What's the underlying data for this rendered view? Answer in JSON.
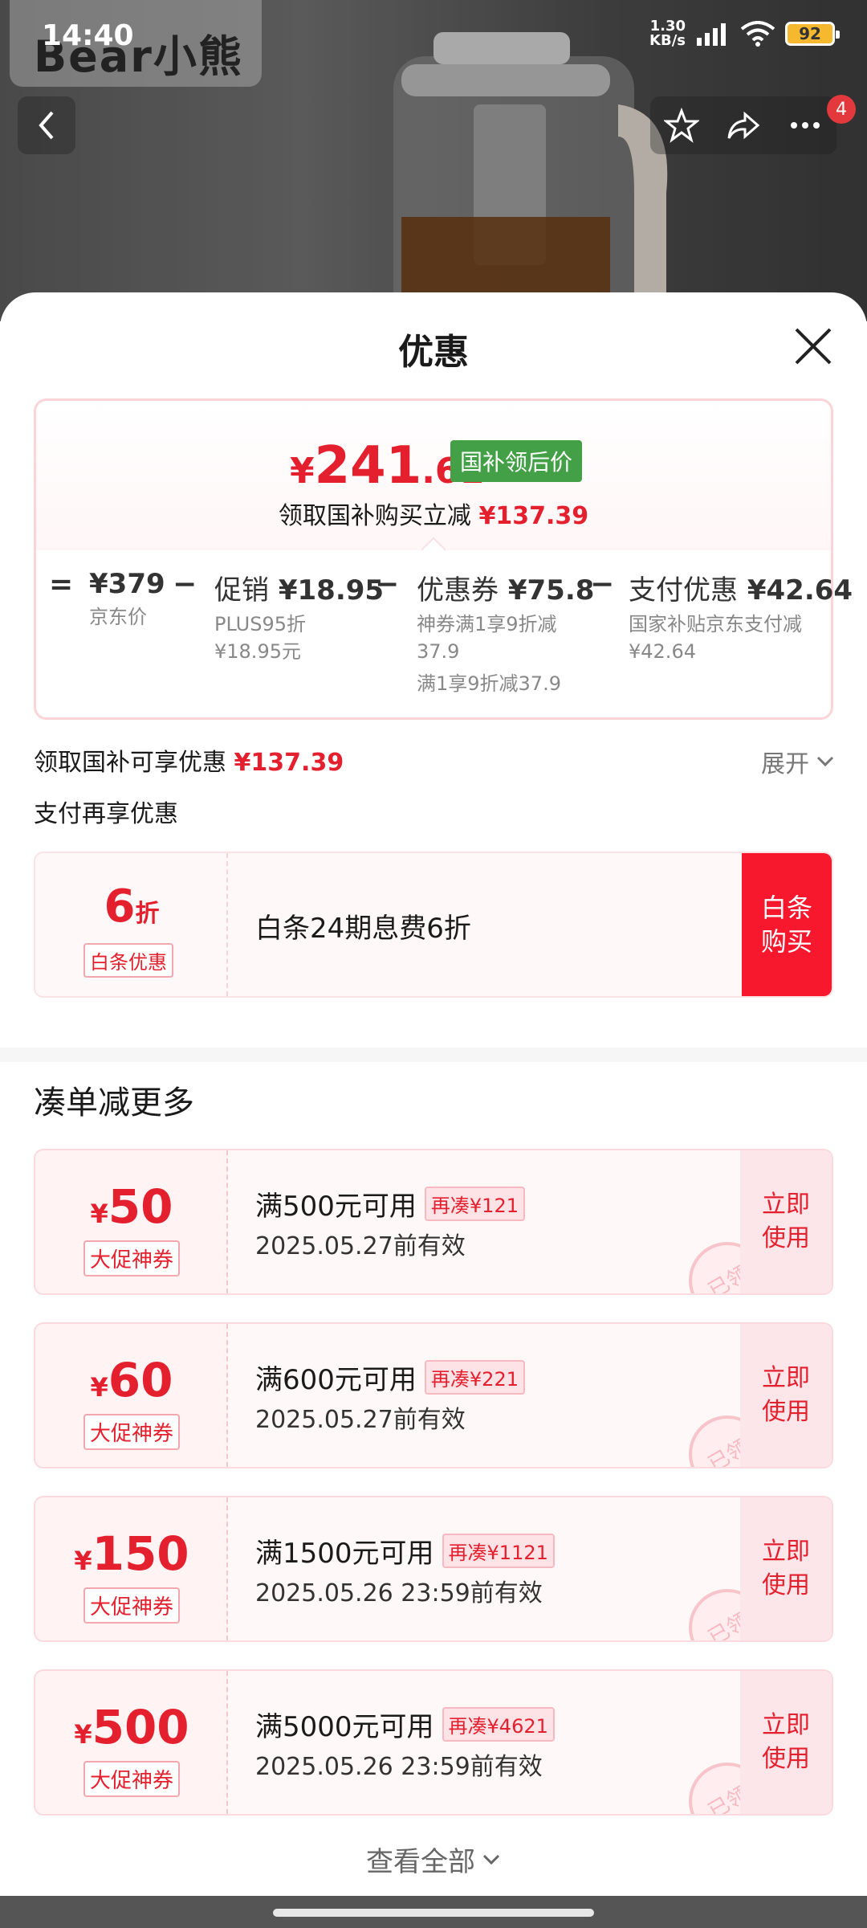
{
  "status_bar": {
    "time": "14:40",
    "net_speed_value": "1.30",
    "net_speed_unit": "KB/s",
    "battery": "92"
  },
  "background": {
    "brand_logo": "Bear小熊"
  },
  "sheet": {
    "title": "优惠",
    "summary": {
      "currency": "¥",
      "price_int": "241",
      "price_dec": ".61",
      "tag": "国补领后价",
      "sub_text": "领取国补购买立减",
      "sub_amount": "¥137.39"
    },
    "breakdown": [
      {
        "op": "=",
        "label": "",
        "amount": "¥379",
        "sub1": "京东价",
        "sub2": "",
        "sub3": ""
      },
      {
        "op": "−",
        "label": "促销",
        "amount": "¥18.95",
        "sub1": "PLUS95折",
        "sub2": "¥18.95元",
        "sub3": ""
      },
      {
        "op": "−",
        "label": "优惠券",
        "amount": "¥75.8",
        "sub1": "神券满1享9折减",
        "sub2": "37.9",
        "sub3": "满1享9折减37.9"
      },
      {
        "op": "−",
        "label": "支付优惠",
        "amount": "¥42.64",
        "sub1": "国家补贴京东支付减",
        "sub2": "¥42.64",
        "sub3": ""
      }
    ],
    "subsidy_line": {
      "text": "领取国补可享优惠",
      "amount": "¥137.39"
    },
    "expand_label": "展开",
    "pay_line": "支付再享优惠",
    "baitiao": {
      "discount_num": "6",
      "discount_unit": "折",
      "tag": "白条优惠",
      "text": "白条24期息费6折",
      "button": "白条购买"
    },
    "section_title": "凑单减更多",
    "coupons": [
      {
        "currency": "¥",
        "amount": "50",
        "tag": "大促神券",
        "condition": "满500元可用",
        "extra": "再凑¥121",
        "expiry": "2025.05.27前有效",
        "stamp": "已领",
        "button": "立即使用"
      },
      {
        "currency": "¥",
        "amount": "60",
        "tag": "大促神券",
        "condition": "满600元可用",
        "extra": "再凑¥221",
        "expiry": "2025.05.27前有效",
        "stamp": "已领",
        "button": "立即使用"
      },
      {
        "currency": "¥",
        "amount": "150",
        "tag": "大促神券",
        "condition": "满1500元可用",
        "extra": "再凑¥1121",
        "expiry": "2025.05.26 23:59前有效",
        "stamp": "已领",
        "button": "立即使用"
      },
      {
        "currency": "¥",
        "amount": "500",
        "tag": "大促神券",
        "condition": "满5000元可用",
        "extra": "再凑¥4621",
        "expiry": "2025.05.26 23:59前有效",
        "stamp": "已领",
        "button": "立即使用"
      }
    ],
    "view_all": "查看全部"
  },
  "header_actions": {
    "cart_badge": "4"
  },
  "colors": {
    "accent_red": "#e4202e",
    "button_red": "#f7182d",
    "green_tag": "#43a047"
  }
}
